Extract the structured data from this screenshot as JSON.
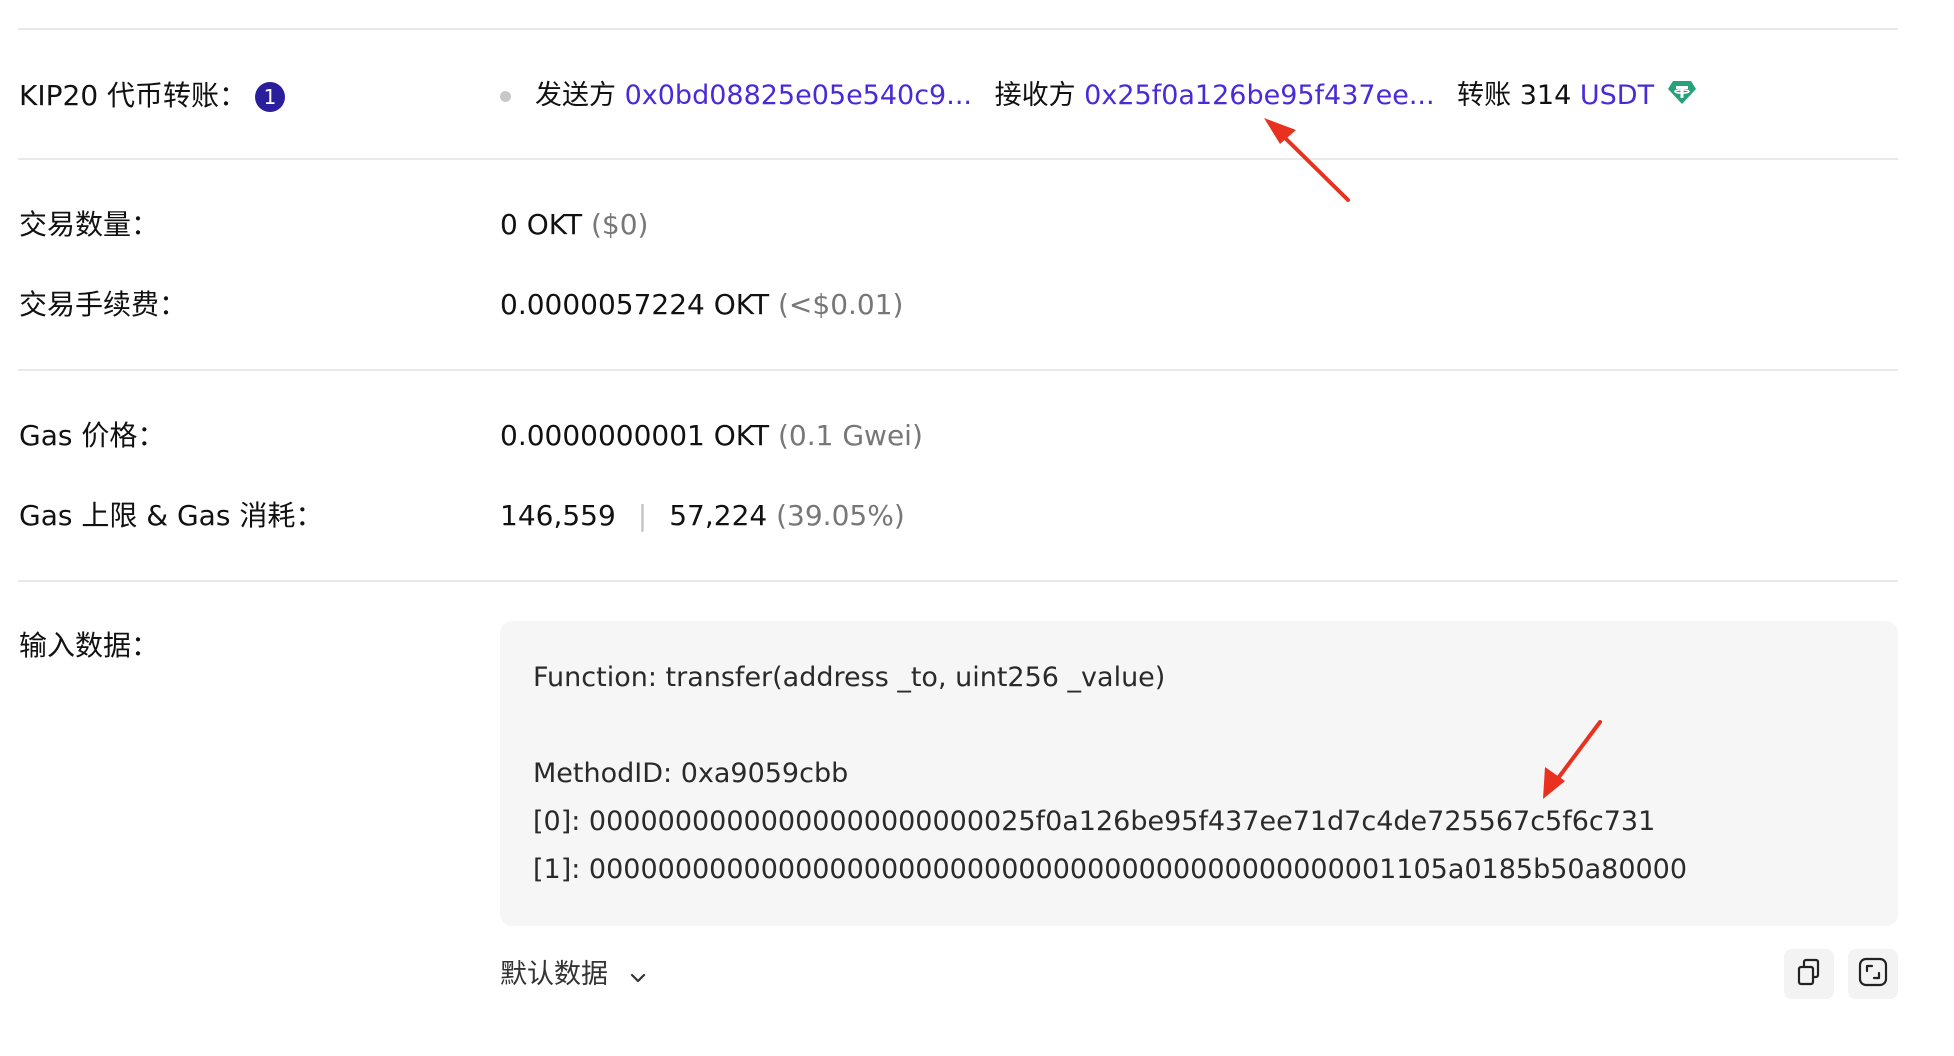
{
  "kip20": {
    "label": "KIP20 代币转账：",
    "count": "1",
    "from_label": "发送方",
    "from_address": "0x0bd08825e05e540c9...",
    "to_label": "接收方",
    "to_address": "0x25f0a126be95f437ee...",
    "transfer_label": "转账 314",
    "token": "USDT"
  },
  "amount": {
    "label": "交易数量：",
    "value": "0 OKT",
    "usd": "($0)"
  },
  "fee": {
    "label": "交易手续费：",
    "value": "0.0000057224 OKT",
    "usd": "(<$0.01)"
  },
  "gas_price": {
    "label": "Gas 价格：",
    "value": "0.0000000001 OKT",
    "gwei": "(0.1 Gwei)"
  },
  "gas_limit": {
    "label": "Gas 上限 & Gas 消耗：",
    "limit": "146,559",
    "separator": "|",
    "used": "57,224",
    "percent": "(39.05%)"
  },
  "input_data": {
    "label": "输入数据：",
    "function": "Function: transfer(address _to, uint256 _value)",
    "method_id": "MethodID: 0xa9059cbb",
    "param0": "[0]: 00000000000000000000000025f0a126be95f437ee71d7c4de725567c5f6c731",
    "param1": "[1]: 00000000000000000000000000000000000000000000001105a0185b50a80000",
    "view_select": "默认数据"
  },
  "colors": {
    "link": "#4a2ad8",
    "badge": "#2a1e9c",
    "usdt": "#26a17b",
    "annotation_arrow": "#e8321f"
  },
  "icons": [
    "chevron-down-icon",
    "copy-icon",
    "expand-icon",
    "usdt-token-icon"
  ]
}
